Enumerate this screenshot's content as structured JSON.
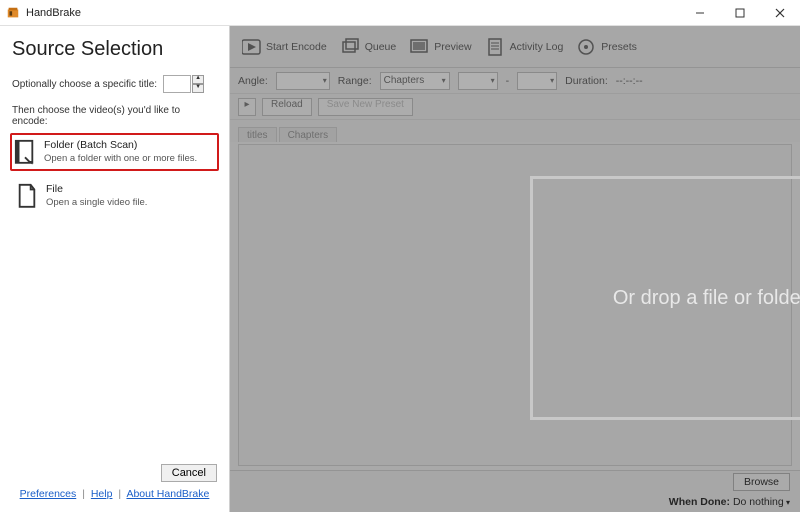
{
  "window": {
    "title": "HandBrake"
  },
  "panel": {
    "heading": "Source Selection",
    "choose_title_label": "Optionally choose a specific title:",
    "then_choose_label": "Then choose the video(s) you'd like to encode:",
    "folder_option": {
      "title": "Folder (Batch Scan)",
      "desc": "Open a folder with one or more files."
    },
    "file_option": {
      "title": "File",
      "desc": "Open a single video file."
    },
    "cancel_label": "Cancel",
    "links": {
      "prefs": "Preferences",
      "help": "Help",
      "about": "About HandBrake"
    }
  },
  "toolbar": {
    "start_encode": "Start Encode",
    "queue": "Queue",
    "preview": "Preview",
    "activity": "Activity Log",
    "presets": "Presets"
  },
  "controls": {
    "angle_label": "Angle:",
    "range_label": "Range:",
    "range_value": "Chapters",
    "duration_label": "Duration:",
    "duration_value": "--:--:--",
    "reload_label": "Reload",
    "save_preset_label": "Save New Preset"
  },
  "tabs": {
    "subtitles": "titles",
    "chapters": "Chapters"
  },
  "bottom": {
    "browse": "Browse",
    "when_done_label": "When Done:",
    "when_done_value": "Do nothing"
  },
  "drop": {
    "text": "Or drop a file or folder here ..."
  }
}
